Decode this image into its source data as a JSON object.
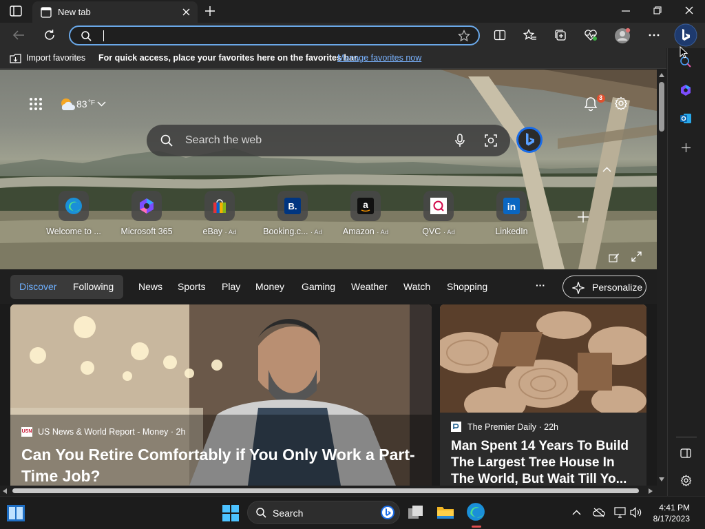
{
  "tab": {
    "title": "New tab"
  },
  "address": {
    "value": ""
  },
  "favorites_bar": {
    "import_label": "Import favorites",
    "message": "For quick access, place your favorites here on the favorites bar.",
    "manage_link": "Manage favorites now"
  },
  "hero": {
    "weather": {
      "temp": "83",
      "unit": "°F"
    },
    "notifications_count": "3",
    "search_placeholder": "Search the web",
    "quick_links": [
      {
        "label": "Welcome to ...",
        "ad": ""
      },
      {
        "label": "Microsoft 365",
        "ad": ""
      },
      {
        "label": "eBay",
        "ad": "· Ad"
      },
      {
        "label": "Booking.c...",
        "ad": "· Ad"
      },
      {
        "label": "Amazon",
        "ad": "· Ad"
      },
      {
        "label": "QVC",
        "ad": "· Ad"
      },
      {
        "label": "LinkedIn",
        "ad": ""
      }
    ]
  },
  "feed_nav": {
    "tabs": [
      "Discover",
      "Following",
      "News",
      "Sports",
      "Play",
      "Money",
      "Gaming",
      "Weather",
      "Watch",
      "Shopping"
    ],
    "more": "···",
    "personalize": "Personalize"
  },
  "cards": [
    {
      "source": "US News & World Report - Money · 2h",
      "source_logo": "USN",
      "headline_line1": "Can You Retire Comfortably if You Only Work a Part-",
      "headline_line2": "Time Job?"
    },
    {
      "source": "The Premier Daily · 22h",
      "headline_line1": "Man Spent 14 Years To Build",
      "headline_line2": "The Largest Tree House In",
      "headline_line3": "The World, But Wait Till Yo..."
    }
  ],
  "taskbar": {
    "search_label": "Search",
    "time": "4:41 PM",
    "date": "8/17/2023"
  },
  "colors": {
    "accent": "#6fb0ff",
    "address_border": "#6aa8e8",
    "notification_badge": "#e0502e",
    "bing_blue": "#1a6ce8"
  }
}
